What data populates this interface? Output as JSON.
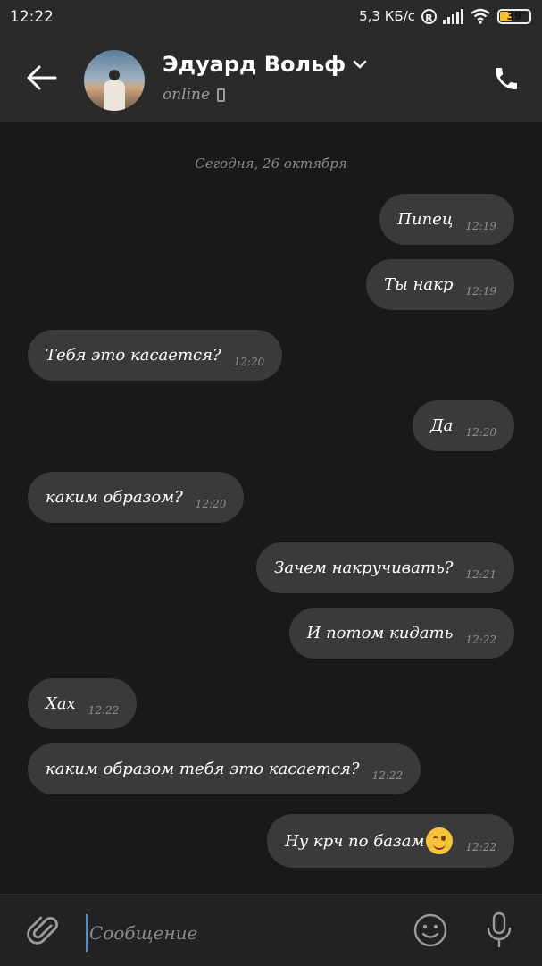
{
  "status_bar": {
    "time": "12:22",
    "speed": "5,3 КБ/с",
    "roaming": "R",
    "battery": "39"
  },
  "header": {
    "contact_name": "Эдуард Вольф",
    "status": "online"
  },
  "date_separator": "Сегодня, 26 октября",
  "messages": [
    {
      "side": "out",
      "text": "Пипец",
      "time": "12:19"
    },
    {
      "side": "out",
      "text": "Ты накр",
      "time": "12:19"
    },
    {
      "side": "in",
      "text": "Тебя это касается?",
      "time": "12:20"
    },
    {
      "side": "out",
      "text": "Да",
      "time": "12:20"
    },
    {
      "side": "in",
      "text": "каким образом?",
      "time": "12:20"
    },
    {
      "side": "out",
      "text": "Зачем накручивать?",
      "time": "12:21"
    },
    {
      "side": "out",
      "text": "И потом кидать",
      "time": "12:22"
    },
    {
      "side": "in",
      "text": "Хах",
      "time": "12:22"
    },
    {
      "side": "in",
      "text": "каким образом тебя это касается?",
      "time": "12:22"
    },
    {
      "side": "out",
      "text": "Ну крч по базам",
      "time": "12:22",
      "emoji": "wink-emoji"
    }
  ],
  "composer": {
    "placeholder": "Сообщение"
  }
}
